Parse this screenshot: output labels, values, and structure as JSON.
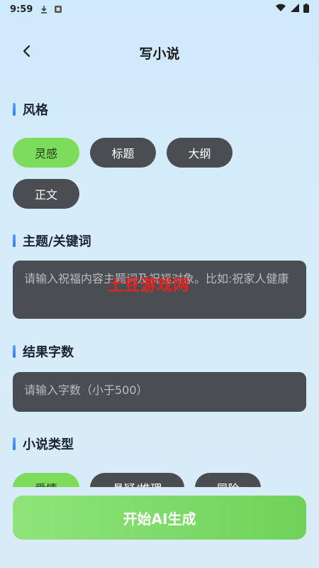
{
  "status": {
    "time": "9:59"
  },
  "header": {
    "title": "写小说"
  },
  "style_section": {
    "title": "风格",
    "options": [
      "灵感",
      "标题",
      "大纲",
      "正文"
    ],
    "selected": "灵感"
  },
  "topic_section": {
    "title": "主题/关键词",
    "placeholder": "请输入祝福内容主题词及祝福对象。比如:祝家人健康"
  },
  "watermark": {
    "text": "土豆游戏网"
  },
  "count_section": {
    "title": "结果字数",
    "placeholder": "请输入字数（小于500）"
  },
  "type_section": {
    "title": "小说类型",
    "options": [
      "爱情",
      "悬疑/推理",
      "冒险"
    ],
    "selected": "爱情"
  },
  "actions": {
    "start_label": "开始AI生成"
  },
  "colors": {
    "accent_green": "#7ddc5c",
    "chip_dark": "#4a4e52",
    "section_bar": "#2f7bf0"
  }
}
